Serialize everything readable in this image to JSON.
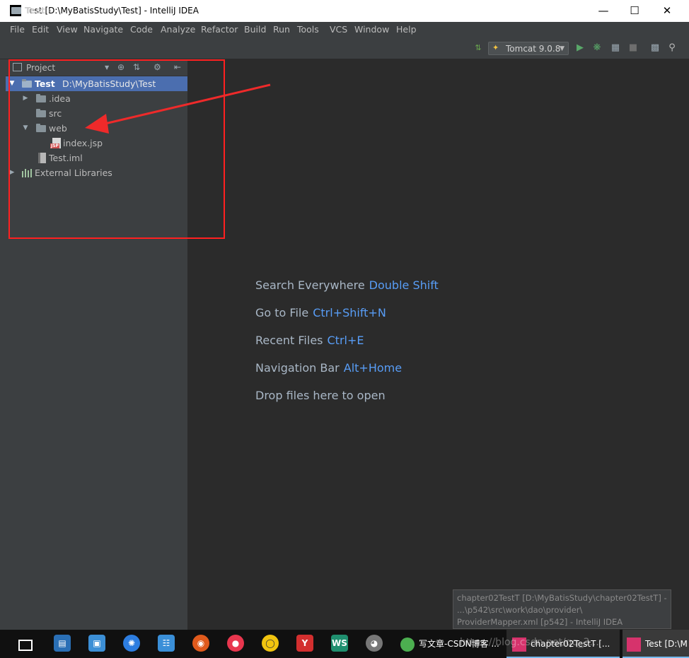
{
  "window": {
    "title": "Test [D:\\MyBatisStudy\\Test] - IntelliJ IDEA",
    "icon_label": "IJ"
  },
  "menu": [
    "File",
    "Edit",
    "View",
    "Navigate",
    "Code",
    "Analyze",
    "Refactor",
    "Build",
    "Run",
    "Tools",
    "VCS",
    "Window",
    "Help"
  ],
  "navbar": {
    "breadcrumb": "Test",
    "run_config": "Tomcat 9.0.8"
  },
  "project_panel": {
    "title": "Project",
    "tree": [
      {
        "label": "Test",
        "detail": "D:\\MyBatisStudy\\Test",
        "selected": true
      },
      {
        "label": ".idea"
      },
      {
        "label": "src"
      },
      {
        "label": "web"
      },
      {
        "label": "index.jsp"
      },
      {
        "label": "Test.iml"
      },
      {
        "label": "External Libraries"
      }
    ]
  },
  "editor_hints": [
    {
      "text": "Search Everywhere",
      "key": "Double Shift"
    },
    {
      "text": "Go to File",
      "key": "Ctrl+Shift+N"
    },
    {
      "text": "Recent Files",
      "key": "Ctrl+E"
    },
    {
      "text": "Navigation Bar",
      "key": "Alt+Home"
    },
    {
      "text": "Drop files here to open",
      "key": ""
    }
  ],
  "tooltip": {
    "line1": "chapter02TestT [D:\\MyBatisStudy\\chapter02TestT] -",
    "line2": "...\\p542\\src\\work\\dao\\provider\\",
    "line3": "ProviderMapper.xml [p542] - IntelliJ IDEA"
  },
  "taskbar": {
    "task1": "写文章-CSDN博客 ...",
    "task2": "chapter02TestT [...",
    "task3": "Test [D:\\M",
    "watermark": "https://blog.csdn.net/qq_3..."
  },
  "colors": {
    "accent": "#589df6",
    "selection": "#4b6eaf",
    "annotation": "#ff2020"
  }
}
